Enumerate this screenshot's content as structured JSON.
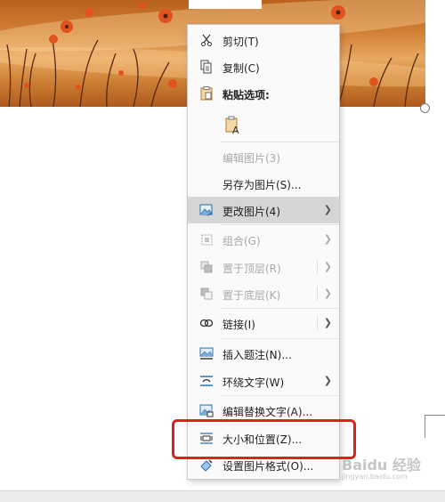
{
  "menu": {
    "items": [
      {
        "label": "剪切(T)",
        "icon": "scissors-icon"
      },
      {
        "label": "复制(C)",
        "icon": "copy-icon"
      },
      {
        "label": "粘贴选项:",
        "icon": "clipboard-icon"
      },
      {
        "label": "",
        "icon": "paste-text-only-icon"
      },
      {
        "label": "编辑图片(3)",
        "icon": "",
        "disabled": true
      },
      {
        "label": "另存为图片(S)...",
        "icon": ""
      },
      {
        "label": "更改图片(4)",
        "icon": "change-picture-icon",
        "highlighted": true
      },
      {
        "label": "组合(G)",
        "icon": "group-icon",
        "disabled": true
      },
      {
        "label": "置于顶层(R)",
        "icon": "bring-front-icon",
        "disabled": true
      },
      {
        "label": "置于底层(K)",
        "icon": "send-back-icon",
        "disabled": true
      },
      {
        "label": "链接(I)",
        "icon": "link-icon"
      },
      {
        "label": "插入题注(N)...",
        "icon": "insert-caption-icon"
      },
      {
        "label": "环绕文字(W)",
        "icon": "wrap-text-icon"
      },
      {
        "label": "编辑替换文字(A)...",
        "icon": "alt-text-icon"
      },
      {
        "label": "大小和位置(Z)...",
        "icon": "size-position-icon"
      },
      {
        "label": "设置图片格式(O)...",
        "icon": "format-picture-icon"
      }
    ]
  },
  "watermark": {
    "brand": "Baidu 经验",
    "url": "jingyan.baidu.com"
  },
  "colors": {
    "highlight": "#d5d5d5",
    "red_box": "#e0201b"
  }
}
